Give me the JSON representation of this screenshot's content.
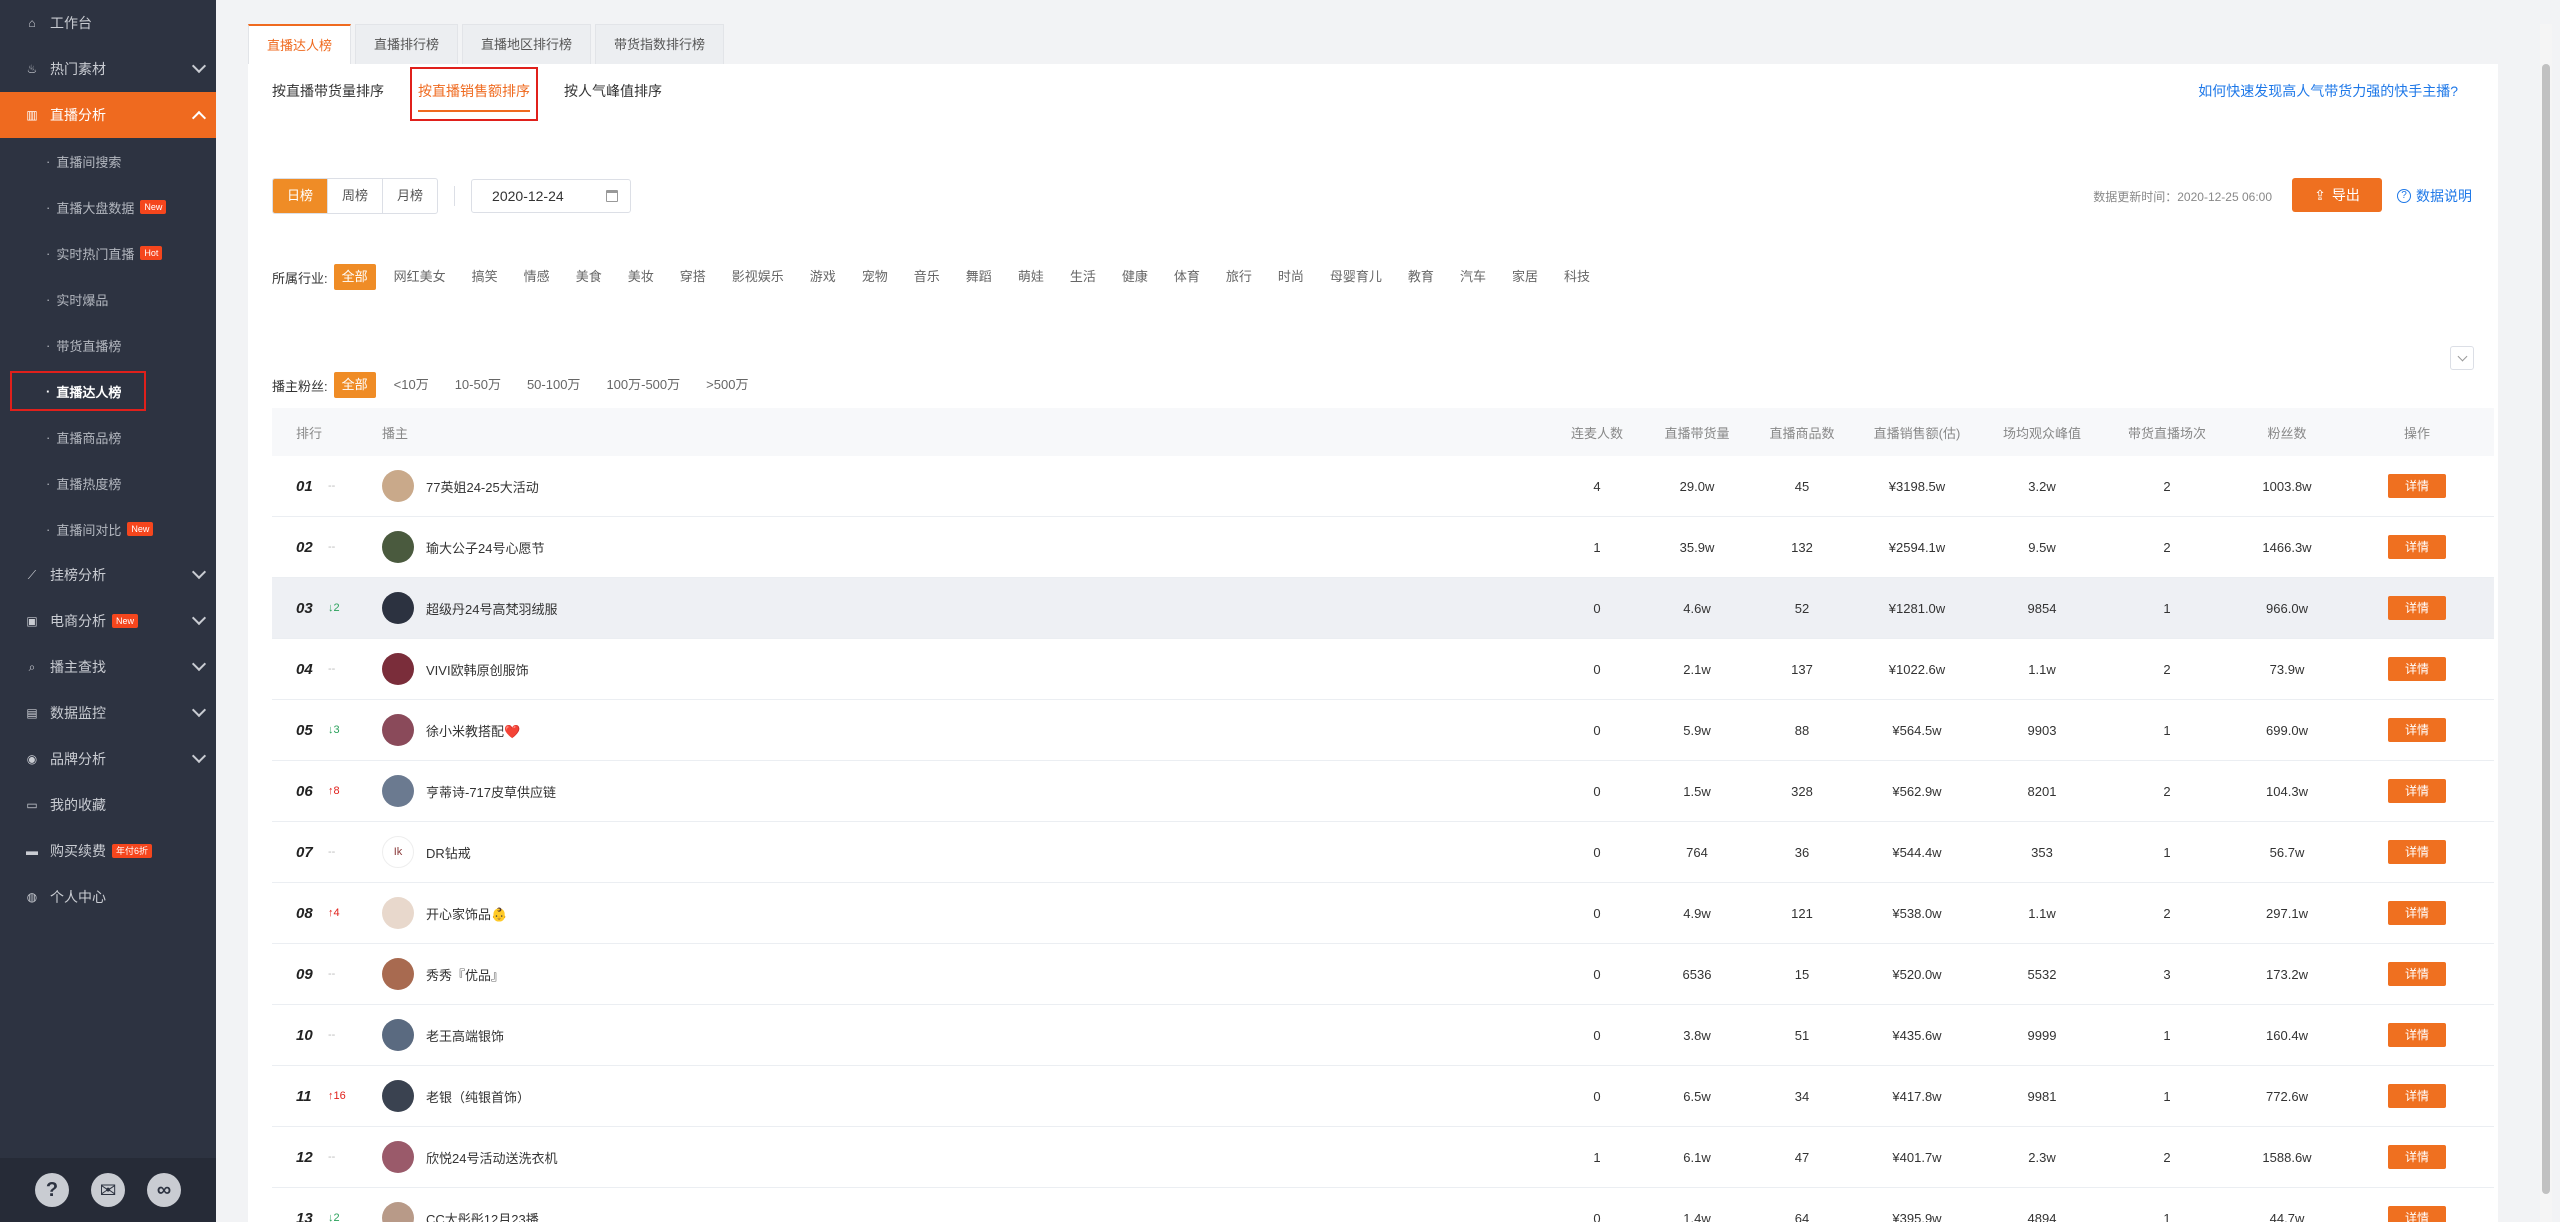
{
  "sidebar": {
    "items": [
      {
        "name": "workbench",
        "label": "工作台",
        "icon": "home-icon",
        "glyph": "⌂",
        "chev": false
      },
      {
        "name": "hot-materials",
        "label": "热门素材",
        "icon": "flame-icon",
        "glyph": "♨",
        "chev": true
      },
      {
        "name": "live-analysis",
        "label": "直播分析",
        "icon": "bar-chart-icon",
        "glyph": "▥",
        "chev": true,
        "active": true
      }
    ],
    "sub_items": [
      {
        "label": "直播间搜索"
      },
      {
        "label": "直播大盘数据",
        "badge": "New"
      },
      {
        "label": "实时热门直播",
        "badge": "Hot"
      },
      {
        "label": "实时爆品"
      },
      {
        "label": "带货直播榜"
      },
      {
        "label": "直播达人榜",
        "current": true
      },
      {
        "label": "直播商品榜"
      },
      {
        "label": "直播热度榜"
      },
      {
        "label": "直播间对比",
        "badge": "New"
      }
    ],
    "items_after": [
      {
        "name": "hanging-analysis",
        "label": "挂榜分析",
        "icon": "trend-icon",
        "glyph": "⟋",
        "chev": true
      },
      {
        "name": "ecommerce-analysis",
        "label": "电商分析",
        "icon": "cart-icon",
        "glyph": "▣",
        "chev": true,
        "badge": "New"
      },
      {
        "name": "anchor-search",
        "label": "播主查找",
        "icon": "search-icon",
        "glyph": "⌕",
        "chev": true
      },
      {
        "name": "data-monitor",
        "label": "数据监控",
        "icon": "monitor-icon",
        "glyph": "▤",
        "chev": true
      },
      {
        "name": "brand-analysis",
        "label": "品牌分析",
        "icon": "brand-icon",
        "glyph": "◉",
        "chev": true
      },
      {
        "name": "my-favorites",
        "label": "我的收藏",
        "icon": "folder-icon",
        "glyph": "▭",
        "chev": false
      },
      {
        "name": "purchase-renew",
        "label": "购买续费",
        "icon": "card-icon",
        "glyph": "▬",
        "chev": false,
        "badge": "年付6折"
      },
      {
        "name": "personal-center",
        "label": "个人中心",
        "icon": "user-icon",
        "glyph": "◍",
        "chev": false
      }
    ],
    "bottom": {
      "help": "?",
      "wechat": "✉",
      "link": "∞"
    }
  },
  "tabs": [
    "直播达人榜",
    "直播排行榜",
    "直播地区排行榜",
    "带货指数排行榜"
  ],
  "subtabs": [
    "按直播带货量排序",
    "按直播销售额排序",
    "按人气峰值排序"
  ],
  "help_link": "如何快速发现高人气带货力强的快手主播?",
  "period": [
    "日榜",
    "周榜",
    "月榜"
  ],
  "date": "2020-12-24",
  "update_time": "数据更新时间：2020-12-25 06:00",
  "export_label": "导出",
  "data_desc": "数据说明",
  "industry": {
    "label": "所属行业:",
    "options": [
      "全部",
      "网红美女",
      "搞笑",
      "情感",
      "美食",
      "美妆",
      "穿搭",
      "影视娱乐",
      "游戏",
      "宠物",
      "音乐",
      "舞蹈",
      "萌娃",
      "生活",
      "健康",
      "体育",
      "旅行",
      "时尚",
      "母婴育儿",
      "教育",
      "汽车",
      "家居",
      "科技"
    ]
  },
  "fans": {
    "label": "播主粉丝:",
    "options": [
      "全部",
      "<10万",
      "10-50万",
      "50-100万",
      "100万-500万",
      ">500万"
    ]
  },
  "table": {
    "headers": [
      "排行",
      "播主",
      "连麦人数",
      "直播带货量",
      "直播商品数",
      "直播销售额(估)",
      "场均观众峰值",
      "带货直播场次",
      "粉丝数",
      "操作"
    ],
    "detail_label": "详情",
    "rows": [
      {
        "rank": "01",
        "trend": "--",
        "trend_type": "flat",
        "name": "77英姐24-25大活动",
        "avatar_color": "#c9a98a",
        "lianmai": "4",
        "volume": "29.0w",
        "goods": "45",
        "sales": "¥3198.5w",
        "peak": "3.2w",
        "sessions": "2",
        "fans": "1003.8w"
      },
      {
        "rank": "02",
        "trend": "--",
        "trend_type": "flat",
        "name": "瑜大公子24号心愿节",
        "avatar_color": "#4a5a3e",
        "lianmai": "1",
        "volume": "35.9w",
        "goods": "132",
        "sales": "¥2594.1w",
        "peak": "9.5w",
        "sessions": "2",
        "fans": "1466.3w"
      },
      {
        "rank": "03",
        "trend": "↓2",
        "trend_type": "down",
        "name": "超级丹24号高梵羽绒服",
        "avatar_color": "#2c3240",
        "lianmai": "0",
        "volume": "4.6w",
        "goods": "52",
        "sales": "¥1281.0w",
        "peak": "9854",
        "sessions": "1",
        "fans": "966.0w",
        "highlight": true
      },
      {
        "rank": "04",
        "trend": "--",
        "trend_type": "flat",
        "name": "VIVI欧韩原创服饰",
        "avatar_color": "#7a2d3a",
        "lianmai": "0",
        "volume": "2.1w",
        "goods": "137",
        "sales": "¥1022.6w",
        "peak": "1.1w",
        "sessions": "2",
        "fans": "73.9w"
      },
      {
        "rank": "05",
        "trend": "↓3",
        "trend_type": "down",
        "name": "徐小米教搭配❤️",
        "avatar_color": "#8a4a5a",
        "lianmai": "0",
        "volume": "5.9w",
        "goods": "88",
        "sales": "¥564.5w",
        "peak": "9903",
        "sessions": "1",
        "fans": "699.0w"
      },
      {
        "rank": "06",
        "trend": "↑8",
        "trend_type": "up",
        "name": "亨蒂诗-717皮草供应链",
        "avatar_color": "#6b7a90",
        "lianmai": "0",
        "volume": "1.5w",
        "goods": "328",
        "sales": "¥562.9w",
        "peak": "8201",
        "sessions": "2",
        "fans": "104.3w"
      },
      {
        "rank": "07",
        "trend": "--",
        "trend_type": "flat",
        "name": "DR钻戒",
        "avatar_color": "#ffffff",
        "avatar_text": "Ik",
        "lianmai": "0",
        "volume": "764",
        "goods": "36",
        "sales": "¥544.4w",
        "peak": "353",
        "sessions": "1",
        "fans": "56.7w"
      },
      {
        "rank": "08",
        "trend": "↑4",
        "trend_type": "up",
        "name": "开心家饰品👶",
        "avatar_color": "#e8d8cc",
        "lianmai": "0",
        "volume": "4.9w",
        "goods": "121",
        "sales": "¥538.0w",
        "peak": "1.1w",
        "sessions": "2",
        "fans": "297.1w"
      },
      {
        "rank": "09",
        "trend": "--",
        "trend_type": "flat",
        "name": "秀秀『优品』",
        "avatar_color": "#a86a50",
        "lianmai": "0",
        "volume": "6536",
        "goods": "15",
        "sales": "¥520.0w",
        "peak": "5532",
        "sessions": "3",
        "fans": "173.2w"
      },
      {
        "rank": "10",
        "trend": "--",
        "trend_type": "flat",
        "name": "老王高端银饰",
        "avatar_color": "#5a6a80",
        "lianmai": "0",
        "volume": "3.8w",
        "goods": "51",
        "sales": "¥435.6w",
        "peak": "9999",
        "sessions": "1",
        "fans": "160.4w"
      },
      {
        "rank": "11",
        "trend": "↑16",
        "trend_type": "up",
        "name": "老银（纯银首饰）",
        "avatar_color": "#3a4250",
        "lianmai": "0",
        "volume": "6.5w",
        "goods": "34",
        "sales": "¥417.8w",
        "peak": "9981",
        "sessions": "1",
        "fans": "772.6w"
      },
      {
        "rank": "12",
        "trend": "--",
        "trend_type": "flat",
        "name": "欣悦24号活动送洗衣机",
        "avatar_color": "#9a5a6a",
        "lianmai": "1",
        "volume": "6.1w",
        "goods": "47",
        "sales": "¥401.7w",
        "peak": "2.3w",
        "sessions": "2",
        "fans": "1588.6w"
      },
      {
        "rank": "13",
        "trend": "↓2",
        "trend_type": "down",
        "name": "CC大彤彤12月23播",
        "avatar_color": "#b89a88",
        "lianmai": "0",
        "volume": "1.4w",
        "goods": "64",
        "sales": "¥395.9w",
        "peak": "4894",
        "sessions": "1",
        "fans": "44.7w"
      }
    ]
  }
}
